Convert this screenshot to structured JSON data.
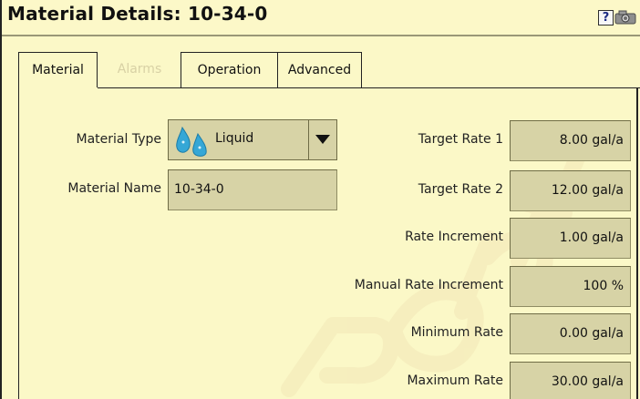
{
  "window": {
    "title": "Material Details: 10-34-0",
    "help_label": "?"
  },
  "tabs": [
    {
      "label": "Material",
      "state": "active"
    },
    {
      "label": "Alarms",
      "state": "disabled"
    },
    {
      "label": "Operation",
      "state": "normal"
    },
    {
      "label": "Advanced",
      "state": "normal"
    }
  ],
  "left_fields": {
    "material_type_label": "Material Type",
    "material_type_value": "Liquid",
    "material_name_label": "Material Name",
    "material_name_value": "10-34-0"
  },
  "right_fields": [
    {
      "label": "Target Rate 1",
      "value": "8.00 gal/a"
    },
    {
      "label": "Target Rate 2",
      "value": "12.00 gal/a"
    },
    {
      "label": "Rate Increment",
      "value": "1.00 gal/a"
    },
    {
      "label": "Manual Rate Increment",
      "value": "100 %"
    },
    {
      "label": "Minimum Rate",
      "value": "0.00 gal/a"
    },
    {
      "label": "Maximum Rate",
      "value": "30.00 gal/a"
    }
  ],
  "icons": [
    "help-icon",
    "camera-icon",
    "liquid-drops-icon",
    "chevron-down-icon"
  ],
  "colors": {
    "background": "#fbf8c7",
    "field": "#d7d3a6",
    "disabled_text": "#d8d1a5",
    "drop": "#35a7d6"
  }
}
